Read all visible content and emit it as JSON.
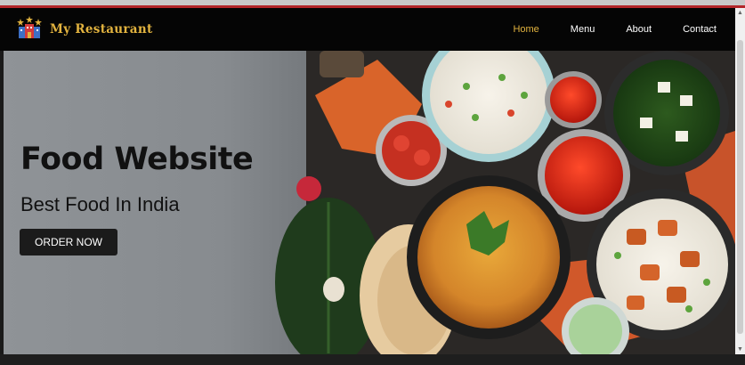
{
  "brand": {
    "name": "My Restaurant",
    "logo_icon": "restaurant-building-icon"
  },
  "nav": {
    "items": [
      {
        "label": "Home",
        "active": true
      },
      {
        "label": "Menu",
        "active": false
      },
      {
        "label": "About",
        "active": false
      },
      {
        "label": "Contact",
        "active": false
      }
    ]
  },
  "hero": {
    "title": "Food Website",
    "subtitle": "Best Food In India",
    "cta_label": "ORDER NOW"
  },
  "colors": {
    "accent": "#e2b33f",
    "navbar": "#050505",
    "stripe": "#b3262a",
    "button": "#1b1b1b"
  }
}
